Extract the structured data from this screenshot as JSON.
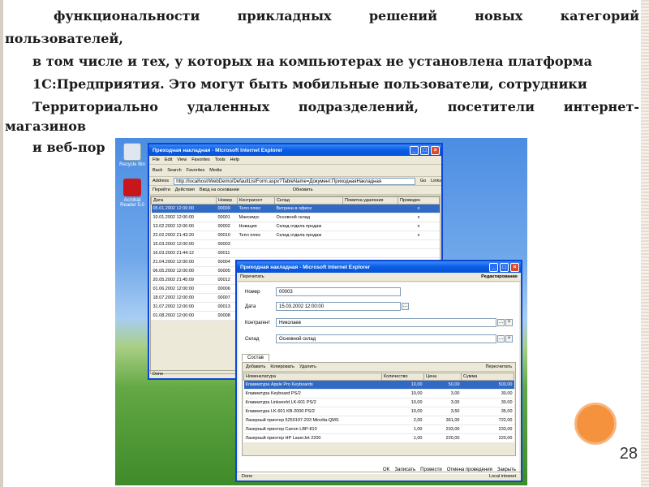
{
  "slide": {
    "lines": [
      "функциональности прикладных решений новых категорий",
      "пользователей,",
      "в том числе и тех, у которых на компьютерах не установлена платформа",
      "1С:Предприятия. Это могут быть мобильные пользователи, сотрудники",
      "Территориально удаленных подразделений, посетители интернет-",
      "магазинов",
      "и веб-пор"
    ],
    "page_number": "28"
  },
  "desktop": {
    "icons": [
      {
        "label": "Recycle Bin"
      },
      {
        "label": "Acrobat Reader 5.0"
      }
    ]
  },
  "list_window": {
    "title": "Приходная накладная - Microsoft Internet Explorer",
    "menu": [
      "File",
      "Edit",
      "View",
      "Favorites",
      "Tools",
      "Help"
    ],
    "toolbar": [
      "Back",
      "Search",
      "Favorites",
      "Media"
    ],
    "address_label": "Address",
    "address": "http://localhost/WebDemo/DefaultListForm.aspx?TableName=Документ.ПриходнаяНакладная",
    "go_label": "Go",
    "links_label": "Links",
    "actions": {
      "goto": "Перейти",
      "actions": "Действия",
      "input_based": "Ввод на основании",
      "refresh": "Обновить"
    },
    "columns": [
      "Дата",
      "Номер",
      "Контрагент",
      "Склад",
      "Пометка удаления",
      "Проведен"
    ],
    "rows": [
      [
        "05.01.2002 12:00:00",
        "00009",
        "Тепл плюс",
        "Витрина в офисе",
        "",
        "x"
      ],
      [
        "10.01.2002 12:00:00",
        "00001",
        "Максимус",
        "Основной склад",
        "",
        "x"
      ],
      [
        "13.02.2002 12:00:00",
        "00002",
        "Новация",
        "Склад отдела продаж",
        "",
        "x"
      ],
      [
        "22.02.2002 21:43:20",
        "00010",
        "Тепл плюс",
        "Склад отдела продаж",
        "",
        "x"
      ],
      [
        "15.03.2002 12:00:00",
        "00003",
        "",
        "",
        "",
        ""
      ],
      [
        "16.03.2002 21:44:12",
        "00011",
        "",
        "",
        "",
        ""
      ],
      [
        "21.04.2002 12:00:00",
        "00004",
        "",
        "",
        "",
        ""
      ],
      [
        "06.05.2002 12:00:00",
        "00005",
        "",
        "",
        "",
        ""
      ],
      [
        "20.05.2002 21:45:09",
        "00012",
        "",
        "",
        "",
        ""
      ],
      [
        "01.06.2002 12:00:00",
        "00006",
        "",
        "",
        "",
        ""
      ],
      [
        "18.07.2002 12:00:00",
        "00007",
        "",
        "",
        "",
        ""
      ],
      [
        "31.07.2002 12:00:00",
        "00013",
        "",
        "",
        "",
        ""
      ],
      [
        "01.08.2002 12:00:00",
        "00008",
        "",
        "",
        "",
        ""
      ]
    ],
    "status": "Done"
  },
  "form_window": {
    "title": "Приходная накладная - Microsoft Internet Explorer",
    "reread": "Перечитать",
    "mode": "Редактирование",
    "labels": {
      "number": "Номер",
      "date": "Дата",
      "contractor": "Контрагент",
      "warehouse": "Склад"
    },
    "values": {
      "number": "00003",
      "date": "15.03.2002 12:00:00",
      "contractor": "Николаев",
      "warehouse": "Основной склад"
    },
    "tab": "Состав",
    "table_actions": {
      "add": "Добавить",
      "copy": "Копировать",
      "delete": "Удалить",
      "recalc": "Пересчитать"
    },
    "columns": [
      "Номенклатура",
      "Количество",
      "Цена",
      "Сумма"
    ],
    "rows": [
      [
        "Клавиатура Apple Pro Keyboards",
        "10,00",
        "50,00",
        "500,00"
      ],
      [
        "Клавиатура Keyboard PS/2",
        "10,00",
        "3,00",
        "30,00"
      ],
      [
        "Клавиатура Linkworld LK-601 PS/2",
        "10,00",
        "3,00",
        "30,00"
      ],
      [
        "Клавиатура LK-601 KB-2000 PS/2",
        "10,00",
        "3,50",
        "35,00"
      ],
      [
        "Лазерный принтер 5250197-203 Minolta-QMS",
        "2,00",
        "361,00",
        "722,00"
      ],
      [
        "Лазерный принтер Canon LBP-810",
        "1,00",
        "233,00",
        "233,00"
      ],
      [
        "Лазерный принтер HP LaserJet 2200",
        "1,00",
        "220,00",
        "220,00"
      ]
    ],
    "buttons": {
      "ok": "OK",
      "save": "Записать",
      "post": "Провести",
      "unpost": "Отмена проведения",
      "close": "Закрыть"
    },
    "status_left": "Done",
    "status_right": "Local intranet"
  }
}
